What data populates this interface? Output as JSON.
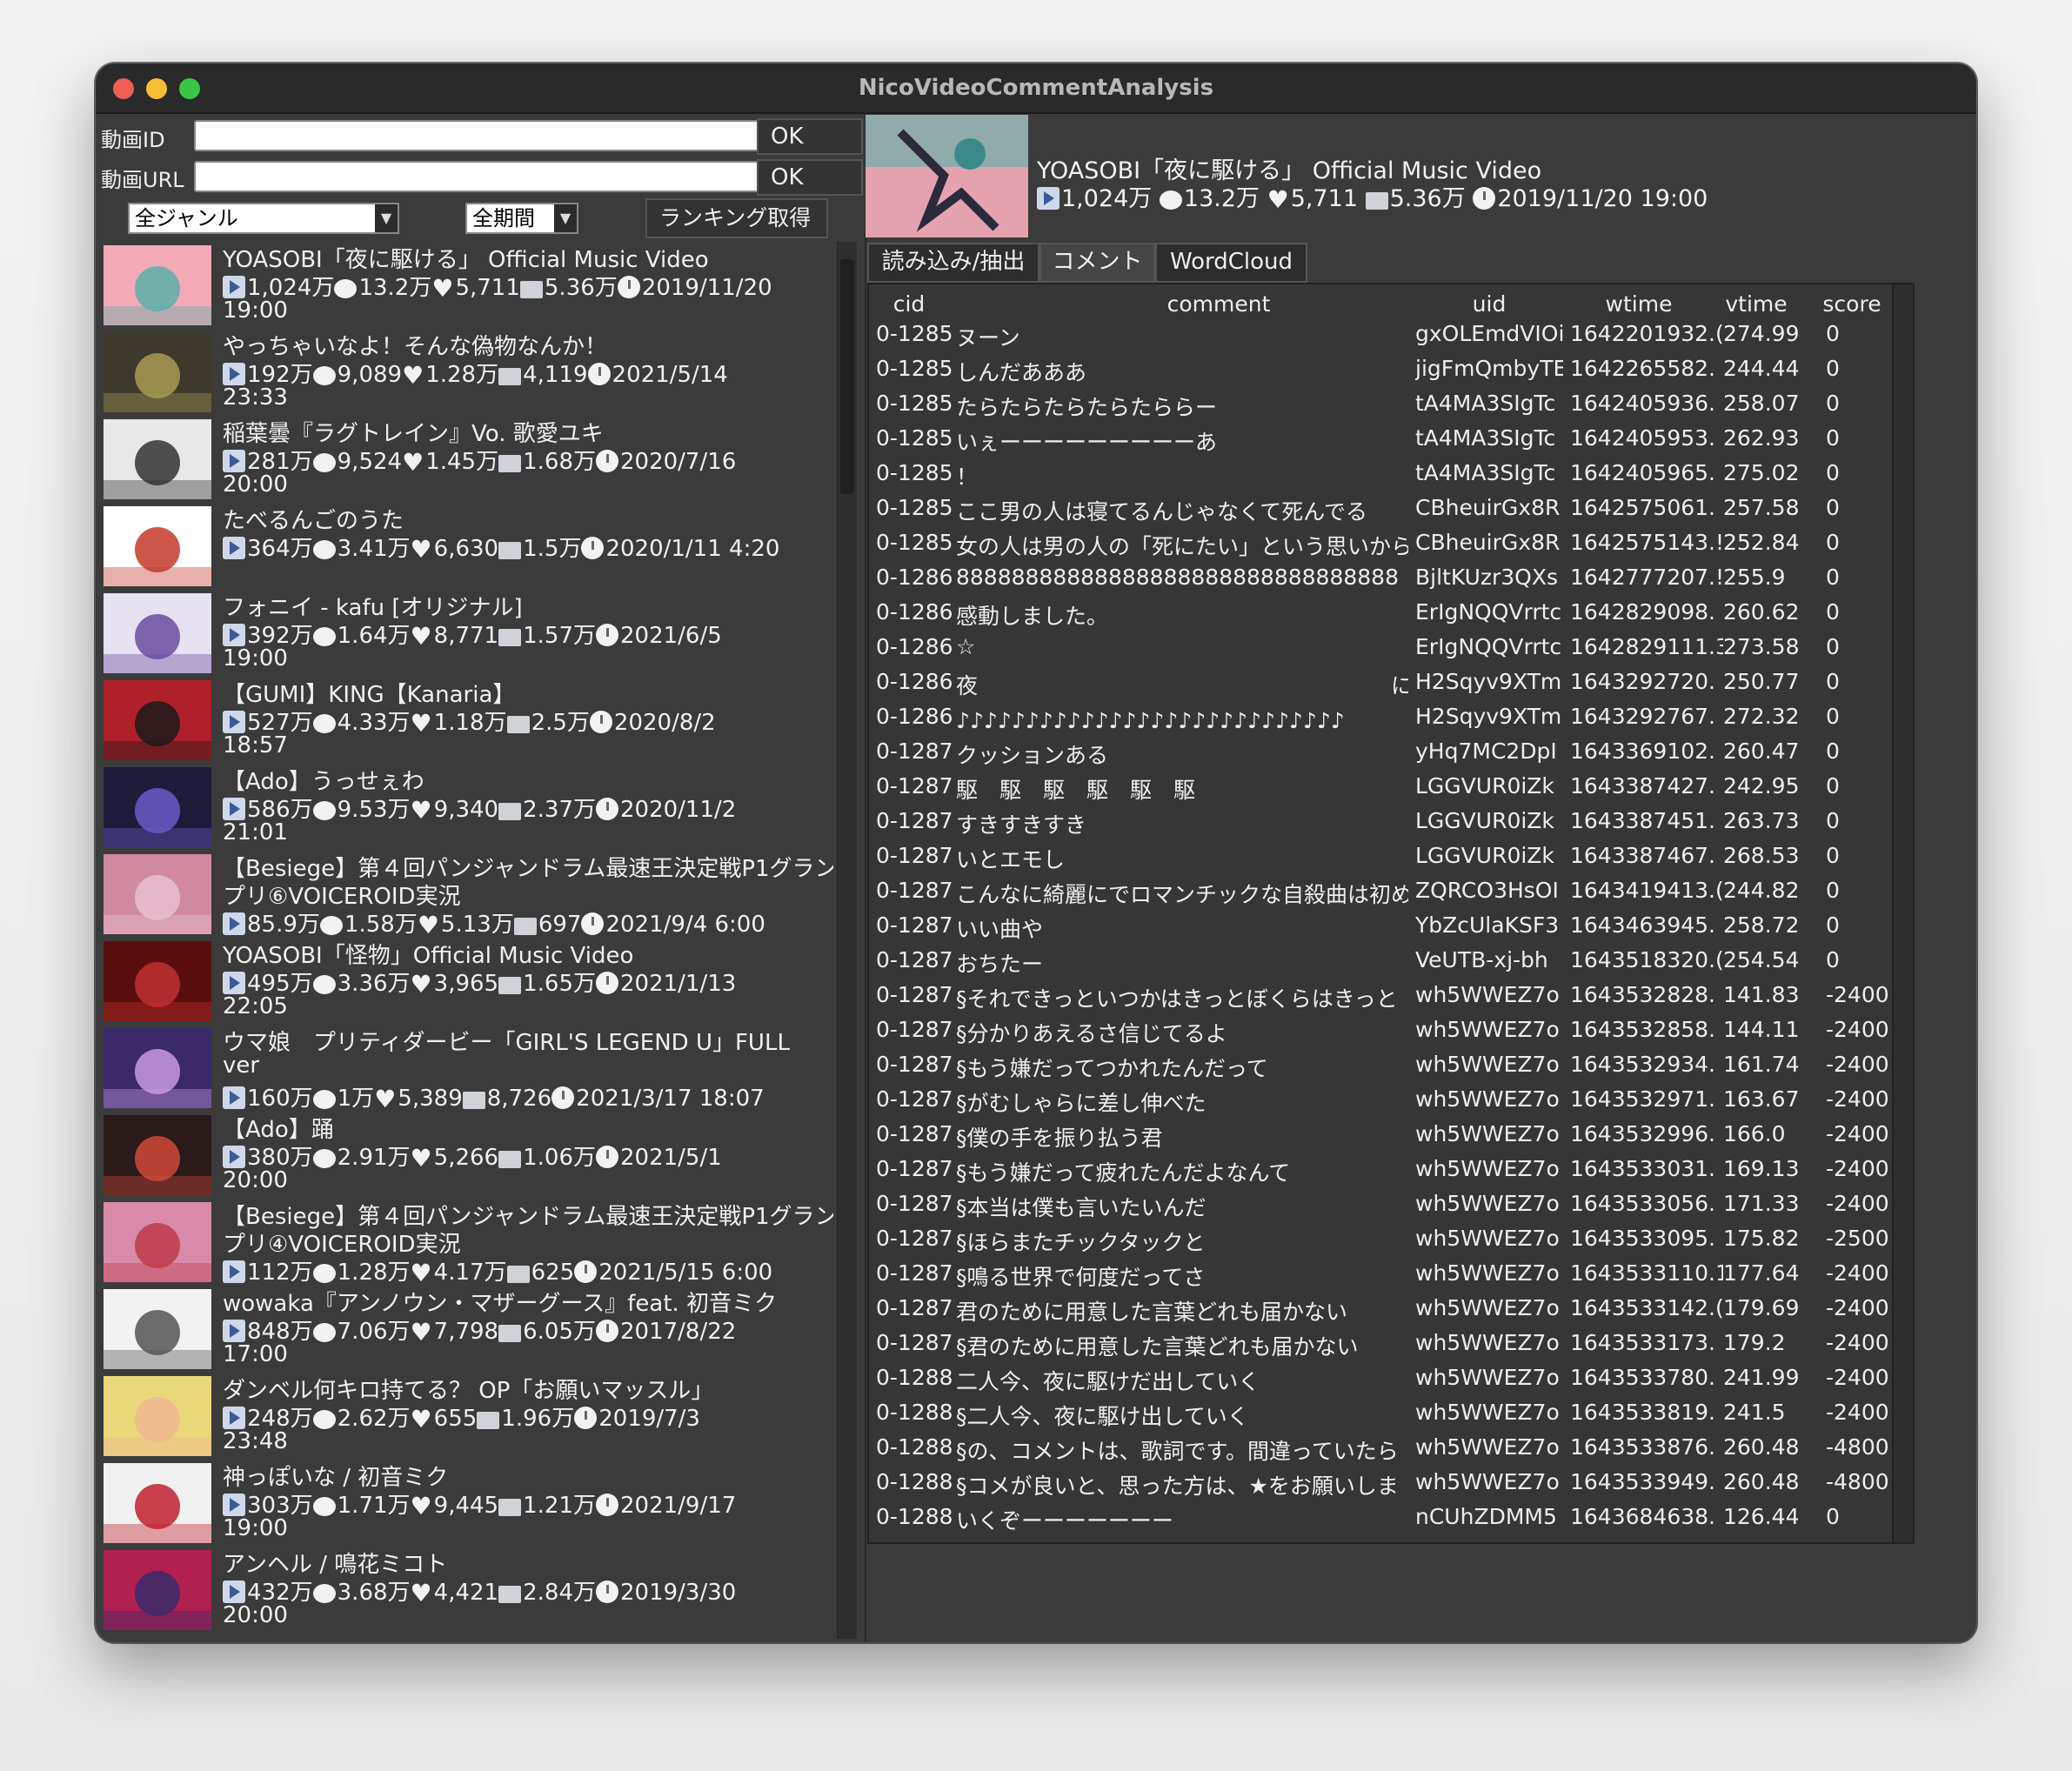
{
  "window": {
    "title": "NicoVideoCommentAnalysis"
  },
  "form": {
    "video_id_label": "動画ID",
    "video_url_label": "動画URL",
    "ok1": "OK",
    "ok2": "OK",
    "genre": "全ジャンル",
    "period": "全期間",
    "ranking_button": "ランキング取得"
  },
  "ranking": [
    {
      "title": "YOASOBI「夜に駆ける」 Official Music Video",
      "views": "1,024万",
      "comments": "13.2万",
      "likes": "5,711",
      "mylist": "5.36万",
      "date": "2019/11/20",
      "time": "19:00",
      "colors": [
        "#f4a9b8",
        "#5ab0a8"
      ]
    },
    {
      "title": "やっちゃいなよ！そんな偽物なんか！",
      "views": "192万",
      "comments": "9,089",
      "likes": "1.28万",
      "mylist": "4,119",
      "date": "2021/5/14",
      "time": "23:33",
      "colors": [
        "#3d3a2c",
        "#a79a55"
      ]
    },
    {
      "title": "稲葉曇『ラグトレイン』Vo. 歌愛ユキ",
      "views": "281万",
      "comments": "9,524",
      "likes": "1.45万",
      "mylist": "1.68万",
      "date": "2020/7/16",
      "time": "20:00",
      "colors": [
        "#e8e8e8",
        "#333333"
      ]
    },
    {
      "title": "たべるんごのうた",
      "views": "364万",
      "comments": "3.41万",
      "likes": "6,630",
      "mylist": "1.5万",
      "date": "2020/1/11 4:20",
      "time": "",
      "colors": [
        "#ffffff",
        "#c43a2a"
      ]
    },
    {
      "title": "フォニイ - kafu [オリジナル]",
      "views": "392万",
      "comments": "1.64万",
      "likes": "8,771",
      "mylist": "1.57万",
      "date": "2021/6/5",
      "time": "19:00",
      "colors": [
        "#e6e2f2",
        "#6a4ca0"
      ]
    },
    {
      "title": "【GUMI】KING【Kanaria】",
      "views": "527万",
      "comments": "4.33万",
      "likes": "1.18万",
      "mylist": "2.5万",
      "date": "2020/8/2",
      "time": "18:57",
      "colors": [
        "#b0202a",
        "#1a1a1a"
      ]
    },
    {
      "title": "【Ado】うっせぇわ",
      "views": "586万",
      "comments": "9.53万",
      "likes": "9,340",
      "mylist": "2.37万",
      "date": "2020/11/2",
      "time": "21:01",
      "colors": [
        "#1c1c3a",
        "#6a5ac8"
      ]
    },
    {
      "title": "【Besiege】第４回パンジャンドラム最速王決定戦P1グラン",
      "title2": "プリ⑥VOICEROID実況",
      "views": "85.9万",
      "comments": "1.58万",
      "likes": "5.13万",
      "mylist": "697",
      "date": "2021/9/4 6:00",
      "time": "",
      "colors": [
        "#d08aa0",
        "#e8c0d0"
      ]
    },
    {
      "title": "YOASOBI「怪物」Official Music Video",
      "views": "495万",
      "comments": "3.36万",
      "likes": "3,965",
      "mylist": "1.65万",
      "date": "2021/1/13",
      "time": "22:05",
      "colors": [
        "#5a0e0e",
        "#c03030"
      ]
    },
    {
      "title": "ウマ娘　プリティダービー「GIRL'S LEGEND U」FULL",
      "title2": "ver",
      "views": "160万",
      "comments": "1万",
      "likes": "5,389",
      "mylist": "8,726",
      "date": "2021/3/17 18:07",
      "time": "",
      "colors": [
        "#3a2a6a",
        "#c89ae0"
      ]
    },
    {
      "title": "【Ado】踊",
      "views": "380万",
      "comments": "2.91万",
      "likes": "5,266",
      "mylist": "1.06万",
      "date": "2021/5/1",
      "time": "20:00",
      "colors": [
        "#2a1a1a",
        "#d04a3a"
      ]
    },
    {
      "title": "【Besiege】第４回パンジャンドラム最速王決定戦P1グラン",
      "title2": "プリ④VOICEROID実況",
      "views": "112万",
      "comments": "1.28万",
      "likes": "4.17万",
      "mylist": "625",
      "date": "2021/5/15 6:00",
      "time": "",
      "colors": [
        "#d88aa8",
        "#c03a4a"
      ]
    },
    {
      "title": "wowaka『アンノウン・マザーグース』feat. 初音ミク",
      "views": "848万",
      "comments": "7.06万",
      "likes": "7,798",
      "mylist": "6.05万",
      "date": "2017/8/22",
      "time": "17:00",
      "colors": [
        "#f2f2f2",
        "#555555"
      ]
    },
    {
      "title": "ダンベル何キロ持てる？ OP「お願いマッスル」",
      "views": "248万",
      "comments": "2.62万",
      "likes": "655",
      "mylist": "1.96万",
      "date": "2019/7/3",
      "time": "23:48",
      "colors": [
        "#e8d87a",
        "#f0b890"
      ]
    },
    {
      "title": "神っぽいな / 初音ミク",
      "views": "303万",
      "comments": "1.71万",
      "likes": "9,445",
      "mylist": "1.21万",
      "date": "2021/9/17",
      "time": "19:00",
      "colors": [
        "#f0f0f0",
        "#c02030"
      ]
    },
    {
      "title": "アンヘル / 鳴花ミコト",
      "views": "432万",
      "comments": "3.68万",
      "likes": "4,421",
      "mylist": "2.84万",
      "date": "2019/3/30",
      "time": "20:00",
      "colors": [
        "#b02050",
        "#3a2a6a"
      ]
    }
  ],
  "selected": {
    "title": "YOASOBI「夜に駆ける」 Official Music Video",
    "views": "1,024万",
    "comments": "13.2万",
    "likes": "5,711",
    "mylist": "5.36万",
    "date": "2019/11/20 19:00"
  },
  "tabs": [
    "読み込み/抽出",
    "コメント",
    "WordCloud"
  ],
  "table": {
    "columns": [
      "cid",
      "comment",
      "uid",
      "wtime",
      "vtime",
      "score"
    ],
    "rows": [
      [
        "0-1285",
        "ヌーン",
        "gxOLEmdVIOi",
        "1642201932.(",
        "274.99",
        "0"
      ],
      [
        "0-1285",
        "しんだあああ",
        "jigFmQmbyTE",
        "1642265582.",
        "244.44",
        "0"
      ],
      [
        "0-1285",
        "たらたらたらたらたららー",
        "tA4MA3SIgTc",
        "1642405936.",
        "258.07",
        "0"
      ],
      [
        "0-1285",
        "いぇーーーーーーーーーあ",
        "tA4MA3SIgTc",
        "1642405953.",
        "262.93",
        "0"
      ],
      [
        "0-1285",
        "！",
        "tA4MA3SIgTc",
        "1642405965.",
        "275.02",
        "0"
      ],
      [
        "0-1285",
        "ここ男の人は寝てるんじゃなくて死んでる",
        "CBheuirGx8R",
        "1642575061.",
        "257.58",
        "0"
      ],
      [
        "0-1285",
        "女の人は男の人の「死にたい」という思いから",
        "CBheuirGx8R",
        "1642575143.!",
        "252.84",
        "0"
      ],
      [
        "0-1286",
        "88888888888888888888888888888888",
        "BjltKUzr3QXs",
        "1642777207.!",
        "255.9",
        "0"
      ],
      [
        "0-1286",
        "感動しました。",
        "ErIgNQQVrrtc",
        "1642829098.",
        "260.62",
        "0"
      ],
      [
        "0-1286",
        "☆",
        "ErIgNQQVrrtc",
        "1642829111.3",
        "273.58",
        "0"
      ],
      [
        "0-1286",
        "夜　　　　　　　　　　　　　　　　　　　に",
        "H2Sqyv9XTm",
        "1643292720.",
        "250.77",
        "0"
      ],
      [
        "0-1286",
        "♪♪♪♪♪♪♪♪♪♪♪♪♪♪♪♪♪♪♪♪♪♪♪♪♪♪♪♪　　　♪♪♪",
        "H2Sqyv9XTm",
        "1643292767.",
        "272.32",
        "0"
      ],
      [
        "0-1287",
        "クッションある",
        "yHq7MC2DpI",
        "1643369102.",
        "260.47",
        "0"
      ],
      [
        "0-1287",
        "駆　駆　駆　駆　駆　駆",
        "LGGVUR0iZk",
        "1643387427.",
        "242.95",
        "0"
      ],
      [
        "0-1287",
        "すきすきすき",
        "LGGVUR0iZk",
        "1643387451.",
        "263.73",
        "0"
      ],
      [
        "0-1287",
        "いとエモし",
        "LGGVUR0iZk",
        "1643387467.",
        "268.53",
        "0"
      ],
      [
        "0-1287",
        "こんなに綺麗にでロマンチックな自殺曲は初め",
        "ZQRCO3HsOI",
        "1643419413.(",
        "244.82",
        "0"
      ],
      [
        "0-1287",
        "いい曲や",
        "YbZcUlaKSF3",
        "1643463945.",
        "258.72",
        "0"
      ],
      [
        "0-1287",
        "おちたー",
        "VeUTB-xj-bh",
        "1643518320.(",
        "254.54",
        "0"
      ],
      [
        "0-1287",
        "§それできっといつかはきっとぼくらはきっと",
        "wh5WWEZ7o",
        "1643532828.",
        "141.83",
        "-2400"
      ],
      [
        "0-1287",
        "§分かりあえるさ信じてるよ",
        "wh5WWEZ7o",
        "1643532858.",
        "144.11",
        "-2400"
      ],
      [
        "0-1287",
        "§もう嫌だってつかれたんだって",
        "wh5WWEZ7o",
        "1643532934.",
        "161.74",
        "-2400"
      ],
      [
        "0-1287",
        "§がむしゃらに差し伸べた",
        "wh5WWEZ7o",
        "1643532971.",
        "163.67",
        "-2400"
      ],
      [
        "0-1287",
        "§僕の手を振り払う君",
        "wh5WWEZ7o",
        "1643532996.",
        "166.0",
        "-2400"
      ],
      [
        "0-1287",
        "§もう嫌だって疲れたんだよなんて",
        "wh5WWEZ7o",
        "1643533031.",
        "169.13",
        "-2400"
      ],
      [
        "0-1287",
        "§本当は僕も言いたいんだ",
        "wh5WWEZ7o",
        "1643533056.",
        "171.33",
        "-2400"
      ],
      [
        "0-1287",
        "§ほらまたチックタックと",
        "wh5WWEZ7o",
        "1643533095.",
        "175.82",
        "-2500"
      ],
      [
        "0-1287",
        "§鳴る世界で何度だってさ",
        "wh5WWEZ7o",
        "1643533110.1",
        "177.64",
        "-2400"
      ],
      [
        "0-1287",
        "君のために用意した言葉どれも届かない",
        "wh5WWEZ7o",
        "1643533142.(",
        "179.69",
        "-2400"
      ],
      [
        "0-1287",
        "§君のために用意した言葉どれも届かない",
        "wh5WWEZ7o",
        "1643533173.",
        "179.2",
        "-2400"
      ],
      [
        "0-1288",
        "二人今、夜に駆けだ出していく",
        "wh5WWEZ7o",
        "1643533780.",
        "241.99",
        "-2400"
      ],
      [
        "0-1288",
        "§二人今、夜に駆け出していく",
        "wh5WWEZ7o",
        "1643533819.",
        "241.5",
        "-2400"
      ],
      [
        "0-1288",
        "§の、コメントは、歌詞です。間違っていたら",
        "wh5WWEZ7o",
        "1643533876.",
        "260.48",
        "-4800"
      ],
      [
        "0-1288",
        "§コメが良いと、思った方は、★をお願いしま",
        "wh5WWEZ7o",
        "1643533949.",
        "260.48",
        "-4800"
      ],
      [
        "0-1288",
        "いくぞーーーーーーー",
        "nCUhZDMM5",
        "1643684638.",
        "126.44",
        "0"
      ]
    ]
  }
}
